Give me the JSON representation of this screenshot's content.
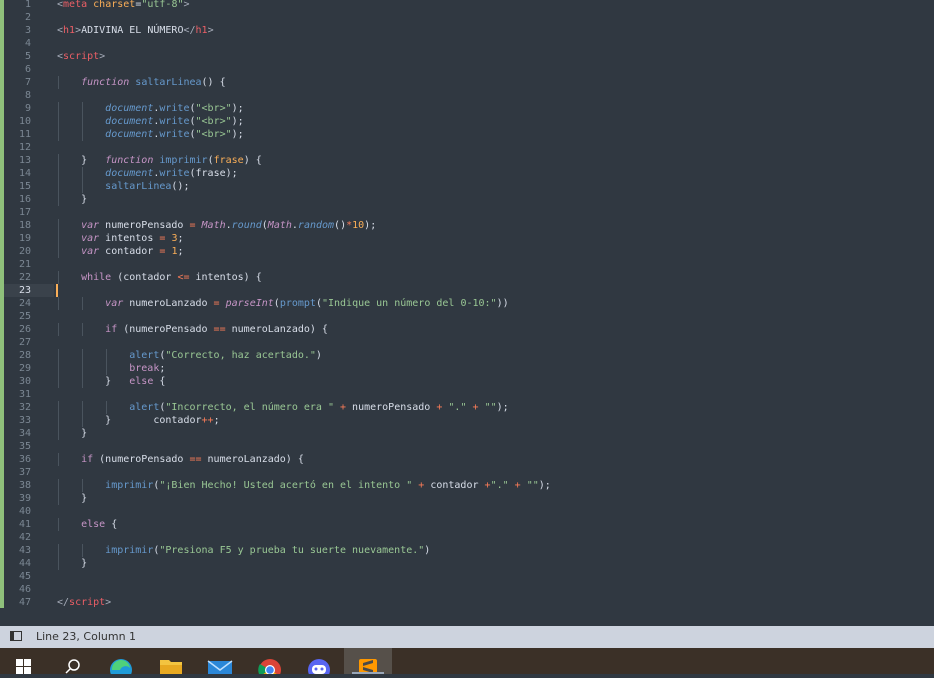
{
  "editor": {
    "active_line": 23,
    "lines": [
      [
        [
          "t-ang",
          "<"
        ],
        [
          "t-tag",
          "meta"
        ],
        [
          "t-txt",
          " "
        ],
        [
          "t-attr",
          "charset"
        ],
        [
          "t-punc",
          "="
        ],
        [
          "t-str",
          "\"utf-8\""
        ],
        [
          "t-ang",
          ">"
        ]
      ],
      [],
      [
        [
          "t-ang",
          "<"
        ],
        [
          "t-tag",
          "h1"
        ],
        [
          "t-ang",
          ">"
        ],
        [
          "t-txt",
          "ADIVINA EL NÚMERO"
        ],
        [
          "t-ang",
          "</"
        ],
        [
          "t-tag",
          "h1"
        ],
        [
          "t-ang",
          ">"
        ]
      ],
      [],
      [
        [
          "t-ang",
          "<"
        ],
        [
          "t-tag",
          "script"
        ],
        [
          "t-ang",
          ">"
        ]
      ],
      [],
      [
        [
          "t-txt",
          "    "
        ],
        [
          "t-kw",
          "function"
        ],
        [
          "t-txt",
          " "
        ],
        [
          "t-fn",
          "saltarLinea"
        ],
        [
          "t-punc",
          "() {"
        ]
      ],
      [],
      [
        [
          "t-txt",
          "        "
        ],
        [
          "t-obj",
          "document"
        ],
        [
          "t-punc",
          "."
        ],
        [
          "t-fn",
          "write"
        ],
        [
          "t-punc",
          "("
        ],
        [
          "t-str",
          "\"<br>\""
        ],
        [
          "t-punc",
          ");"
        ]
      ],
      [
        [
          "t-txt",
          "        "
        ],
        [
          "t-obj",
          "document"
        ],
        [
          "t-punc",
          "."
        ],
        [
          "t-fn",
          "write"
        ],
        [
          "t-punc",
          "("
        ],
        [
          "t-str",
          "\"<br>\""
        ],
        [
          "t-punc",
          ");"
        ]
      ],
      [
        [
          "t-txt",
          "        "
        ],
        [
          "t-obj",
          "document"
        ],
        [
          "t-punc",
          "."
        ],
        [
          "t-fn",
          "write"
        ],
        [
          "t-punc",
          "("
        ],
        [
          "t-str",
          "\"<br>\""
        ],
        [
          "t-punc",
          ");"
        ]
      ],
      [],
      [
        [
          "t-txt",
          "    "
        ],
        [
          "t-punc",
          "}   "
        ],
        [
          "t-kw",
          "function"
        ],
        [
          "t-txt",
          " "
        ],
        [
          "t-fn",
          "imprimir"
        ],
        [
          "t-punc",
          "("
        ],
        [
          "t-par",
          "frase"
        ],
        [
          "t-punc",
          ") {"
        ]
      ],
      [
        [
          "t-txt",
          "        "
        ],
        [
          "t-obj",
          "document"
        ],
        [
          "t-punc",
          "."
        ],
        [
          "t-fn",
          "write"
        ],
        [
          "t-punc",
          "(frase);"
        ]
      ],
      [
        [
          "t-txt",
          "        "
        ],
        [
          "t-fn",
          "saltarLinea"
        ],
        [
          "t-punc",
          "();"
        ]
      ],
      [
        [
          "t-txt",
          "    "
        ],
        [
          "t-punc",
          "}"
        ]
      ],
      [],
      [
        [
          "t-txt",
          "    "
        ],
        [
          "t-kw",
          "var"
        ],
        [
          "t-txt",
          " numeroPensado "
        ],
        [
          "t-op",
          "="
        ],
        [
          "t-txt",
          " "
        ],
        [
          "t-bi",
          "Math"
        ],
        [
          "t-punc",
          "."
        ],
        [
          "t-obj",
          "round"
        ],
        [
          "t-punc",
          "("
        ],
        [
          "t-bi",
          "Math"
        ],
        [
          "t-punc",
          "."
        ],
        [
          "t-obj",
          "random"
        ],
        [
          "t-punc",
          "()"
        ],
        [
          "t-op",
          "*"
        ],
        [
          "t-num",
          "10"
        ],
        [
          "t-punc",
          ");"
        ]
      ],
      [
        [
          "t-txt",
          "    "
        ],
        [
          "t-kw",
          "var"
        ],
        [
          "t-txt",
          " intentos "
        ],
        [
          "t-op",
          "="
        ],
        [
          "t-txt",
          " "
        ],
        [
          "t-num",
          "3"
        ],
        [
          "t-punc",
          ";"
        ]
      ],
      [
        [
          "t-txt",
          "    "
        ],
        [
          "t-kw",
          "var"
        ],
        [
          "t-txt",
          " contador "
        ],
        [
          "t-op",
          "="
        ],
        [
          "t-txt",
          " "
        ],
        [
          "t-num",
          "1"
        ],
        [
          "t-punc",
          ";"
        ]
      ],
      [],
      [
        [
          "t-txt",
          "    "
        ],
        [
          "t-ctl",
          "while"
        ],
        [
          "t-txt",
          " (contador "
        ],
        [
          "t-op",
          "<="
        ],
        [
          "t-txt",
          " intentos) {"
        ]
      ],
      [],
      [
        [
          "t-txt",
          "        "
        ],
        [
          "t-kw",
          "var"
        ],
        [
          "t-txt",
          " numeroLanzado "
        ],
        [
          "t-op",
          "="
        ],
        [
          "t-txt",
          " "
        ],
        [
          "t-bi",
          "parseInt"
        ],
        [
          "t-punc",
          "("
        ],
        [
          "t-fn",
          "prompt"
        ],
        [
          "t-punc",
          "("
        ],
        [
          "t-str",
          "\"Indique un número del 0-10:\""
        ],
        [
          "t-punc",
          "))"
        ]
      ],
      [],
      [
        [
          "t-txt",
          "        "
        ],
        [
          "t-ctl",
          "if"
        ],
        [
          "t-txt",
          " (numeroPensado "
        ],
        [
          "t-op",
          "=="
        ],
        [
          "t-txt",
          " numeroLanzado) {"
        ]
      ],
      [],
      [
        [
          "t-txt",
          "            "
        ],
        [
          "t-fn",
          "alert"
        ],
        [
          "t-punc",
          "("
        ],
        [
          "t-str",
          "\"Correcto, haz acertado.\""
        ],
        [
          "t-punc",
          ")"
        ]
      ],
      [
        [
          "t-txt",
          "            "
        ],
        [
          "t-ctl",
          "break"
        ],
        [
          "t-punc",
          ";"
        ]
      ],
      [
        [
          "t-txt",
          "        "
        ],
        [
          "t-punc",
          "}   "
        ],
        [
          "t-ctl",
          "else"
        ],
        [
          "t-txt",
          " {"
        ]
      ],
      [],
      [
        [
          "t-txt",
          "            "
        ],
        [
          "t-fn",
          "alert"
        ],
        [
          "t-punc",
          "("
        ],
        [
          "t-str",
          "\"Incorrecto, el número era \""
        ],
        [
          "t-txt",
          " "
        ],
        [
          "t-op",
          "+"
        ],
        [
          "t-txt",
          " numeroPensado "
        ],
        [
          "t-op",
          "+"
        ],
        [
          "t-txt",
          " "
        ],
        [
          "t-str",
          "\".\""
        ],
        [
          "t-txt",
          " "
        ],
        [
          "t-op",
          "+"
        ],
        [
          "t-txt",
          " "
        ],
        [
          "t-str",
          "\"\""
        ],
        [
          "t-punc",
          ");"
        ]
      ],
      [
        [
          "t-txt",
          "        "
        ],
        [
          "t-punc",
          "}       "
        ],
        [
          "t-txt",
          "contador"
        ],
        [
          "t-op",
          "++"
        ],
        [
          "t-punc",
          ";"
        ]
      ],
      [
        [
          "t-txt",
          "    "
        ],
        [
          "t-punc",
          "}"
        ]
      ],
      [],
      [
        [
          "t-txt",
          "    "
        ],
        [
          "t-ctl",
          "if"
        ],
        [
          "t-txt",
          " (numeroPensado "
        ],
        [
          "t-op",
          "=="
        ],
        [
          "t-txt",
          " numeroLanzado) {"
        ]
      ],
      [],
      [
        [
          "t-txt",
          "        "
        ],
        [
          "t-fn",
          "imprimir"
        ],
        [
          "t-punc",
          "("
        ],
        [
          "t-str",
          "\"¡Bien Hecho! Usted acertó en el intento \""
        ],
        [
          "t-txt",
          " "
        ],
        [
          "t-op",
          "+"
        ],
        [
          "t-txt",
          " contador "
        ],
        [
          "t-op",
          "+"
        ],
        [
          "t-str",
          "\".\""
        ],
        [
          "t-txt",
          " "
        ],
        [
          "t-op",
          "+"
        ],
        [
          "t-txt",
          " "
        ],
        [
          "t-str",
          "\"\""
        ],
        [
          "t-punc",
          ");"
        ]
      ],
      [
        [
          "t-txt",
          "    "
        ],
        [
          "t-punc",
          "}"
        ]
      ],
      [],
      [
        [
          "t-txt",
          "    "
        ],
        [
          "t-ctl",
          "else"
        ],
        [
          "t-txt",
          " {"
        ]
      ],
      [],
      [
        [
          "t-txt",
          "        "
        ],
        [
          "t-fn",
          "imprimir"
        ],
        [
          "t-punc",
          "("
        ],
        [
          "t-str",
          "\"Presiona F5 y prueba tu suerte nuevamente.\""
        ],
        [
          "t-punc",
          ")"
        ]
      ],
      [
        [
          "t-txt",
          "    "
        ],
        [
          "t-punc",
          "}"
        ]
      ],
      [],
      [],
      [
        [
          "t-ang",
          "</"
        ],
        [
          "t-tag",
          "script"
        ],
        [
          "t-ang",
          ">"
        ]
      ]
    ]
  },
  "status_bar": {
    "panel_icon": "panel-toggle-icon",
    "position_text": "Line 23, Column 1"
  },
  "taskbar": {
    "items": [
      {
        "icon": "windows-start-icon",
        "active": false
      },
      {
        "icon": "search-icon",
        "active": false
      },
      {
        "icon": "edge-browser-icon",
        "active": false
      },
      {
        "icon": "file-explorer-icon",
        "active": false
      },
      {
        "icon": "mail-icon",
        "active": false
      },
      {
        "icon": "chrome-browser-icon",
        "active": false
      },
      {
        "icon": "discord-icon",
        "active": false
      },
      {
        "icon": "sublime-text-icon",
        "active": true
      }
    ]
  },
  "colors": {
    "background": "#303841",
    "gutter_accent": "#8fc07b",
    "caret": "#f9ae58",
    "status_bar": "#cdd3de",
    "taskbar": "#3b3027"
  }
}
